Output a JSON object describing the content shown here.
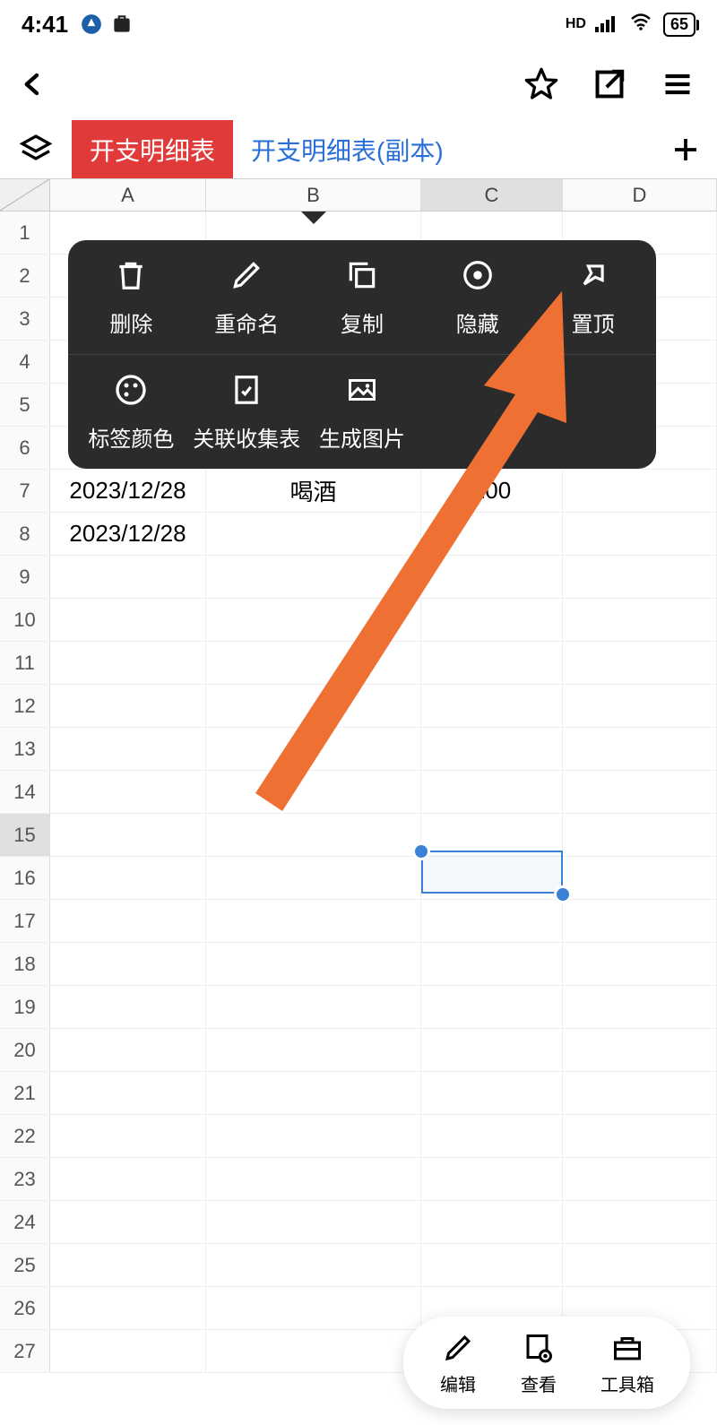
{
  "status": {
    "time": "4:41",
    "hd": "HD",
    "battery": "65"
  },
  "tabs": {
    "active": "开支明细表",
    "inactive": "开支明细表(副本)"
  },
  "columns": [
    "A",
    "B",
    "C",
    "D"
  ],
  "rows": [
    "1",
    "2",
    "3",
    "4",
    "5",
    "6",
    "7",
    "8",
    "9",
    "10",
    "11",
    "12",
    "13",
    "14",
    "15",
    "16",
    "17",
    "18",
    "19",
    "20",
    "21",
    "22",
    "23",
    "24",
    "25",
    "26",
    "27"
  ],
  "cells": {
    "r7": {
      "a": "2023/12/28",
      "b": "喝酒",
      "c": "100"
    },
    "r8": {
      "a": "2023/12/28"
    }
  },
  "ctx": {
    "delete": "删除",
    "rename": "重命名",
    "copy": "复制",
    "hide": "隐藏",
    "pin": "置顶",
    "tagcolor": "标签颜色",
    "linkform": "关联收集表",
    "genimg": "生成图片"
  },
  "bottom": {
    "edit": "编辑",
    "view": "查看",
    "toolbox": "工具箱"
  }
}
